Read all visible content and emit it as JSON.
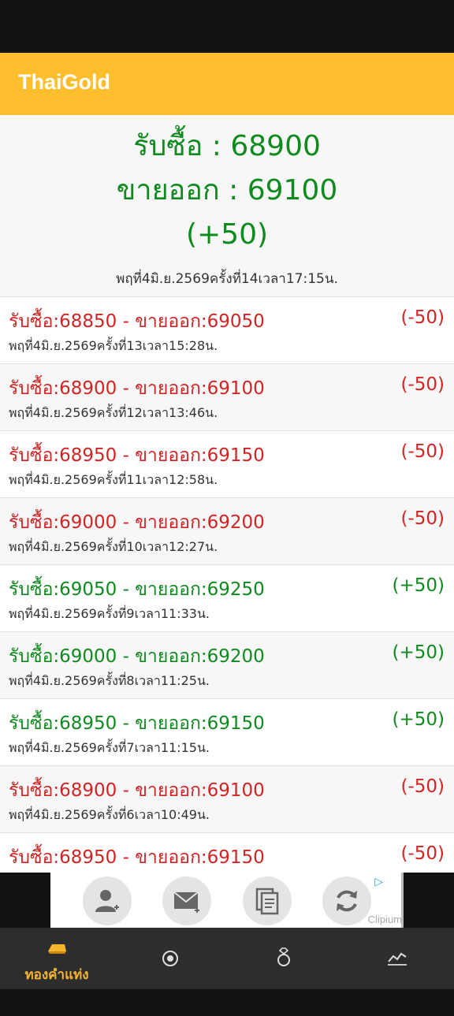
{
  "app": {
    "title": "ThaiGold"
  },
  "summary": {
    "buy": "รับซื้อ : 68900",
    "sell": "ขายออก : 69100",
    "change": "(+50)",
    "updated": "พฤที่4มิ.ย.2569ครั้งที่14เวลา17:15น."
  },
  "history": [
    {
      "price": "รับซื้อ:68850 - ขายออก:69050",
      "change": "(-50)",
      "time": "พฤที่4มิ.ย.2569ครั้งที่13เวลา15:28น.",
      "color": "red"
    },
    {
      "price": "รับซื้อ:68900 - ขายออก:69100",
      "change": "(-50)",
      "time": "พฤที่4มิ.ย.2569ครั้งที่12เวลา13:46น.",
      "color": "red"
    },
    {
      "price": "รับซื้อ:68950 - ขายออก:69150",
      "change": "(-50)",
      "time": "พฤที่4มิ.ย.2569ครั้งที่11เวลา12:58น.",
      "color": "red"
    },
    {
      "price": "รับซื้อ:69000 - ขายออก:69200",
      "change": "(-50)",
      "time": "พฤที่4มิ.ย.2569ครั้งที่10เวลา12:27น.",
      "color": "red"
    },
    {
      "price": "รับซื้อ:69050 - ขายออก:69250",
      "change": "(+50)",
      "time": "พฤที่4มิ.ย.2569ครั้งที่9เวลา11:33น.",
      "color": "green"
    },
    {
      "price": "รับซื้อ:69000 - ขายออก:69200",
      "change": "(+50)",
      "time": "พฤที่4มิ.ย.2569ครั้งที่8เวลา11:25น.",
      "color": "green"
    },
    {
      "price": "รับซื้อ:68950 - ขายออก:69150",
      "change": "(+50)",
      "time": "พฤที่4มิ.ย.2569ครั้งที่7เวลา11:15น.",
      "color": "green"
    },
    {
      "price": "รับซื้อ:68900 - ขายออก:69100",
      "change": "(-50)",
      "time": "พฤที่4มิ.ย.2569ครั้งที่6เวลา10:49น.",
      "color": "red"
    },
    {
      "price": "รับซื้อ:68950 - ขายออก:69150",
      "change": "(-50)",
      "time": "",
      "color": "red"
    }
  ],
  "ad": {
    "brand": "Clipium",
    "icons": [
      "add-contact-icon",
      "add-mail-icon",
      "clipboard-copy-icon",
      "sync-icon"
    ]
  },
  "bottom_nav": {
    "items": [
      {
        "label": "ทองคำแท่ง",
        "icon": "gold-bar-icon",
        "active": true
      },
      {
        "label": "",
        "icon": "gold-ornament-icon",
        "active": false
      },
      {
        "label": "",
        "icon": "ring-icon",
        "active": false
      },
      {
        "label": "",
        "icon": "chart-trend-icon",
        "active": false
      }
    ]
  },
  "colors": {
    "accent": "#FFBE2E",
    "up": "#0e8a1e",
    "down": "#d12424",
    "nav_bg": "#2d2d2d",
    "nav_active": "#F5B52E"
  }
}
